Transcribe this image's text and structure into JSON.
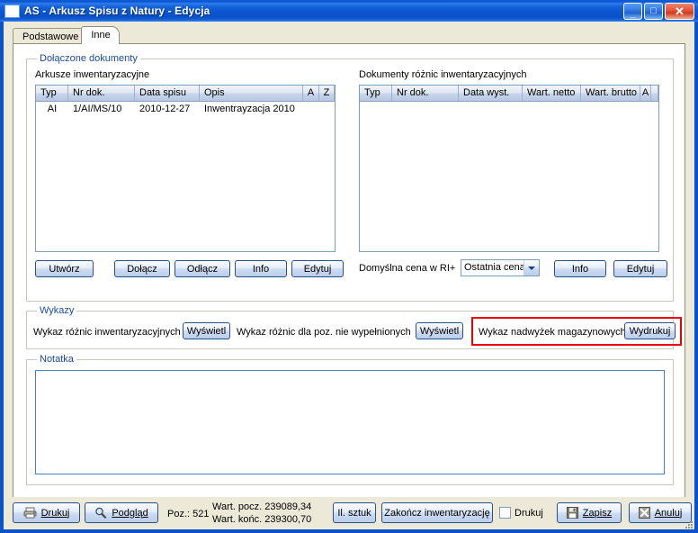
{
  "window": {
    "title": "AS - Arkusz Spisu z Natury - Edycja",
    "icon": "window-icon",
    "buttons": {
      "minimize": "_",
      "maximize": "□",
      "close": "✕"
    }
  },
  "tabs": [
    {
      "label": "Podstawowe",
      "active": false
    },
    {
      "label": "Inne",
      "active": true
    }
  ],
  "groups": {
    "attached_documents": {
      "legend": "Dołączone dokumenty"
    },
    "lists": {
      "legend": "Wykazy"
    },
    "note": {
      "legend": "Notatka"
    }
  },
  "inventory_sheets": {
    "label": "Arkusze inwentaryzacyjne",
    "columns": [
      "Typ",
      "Nr dok.",
      "Data spisu",
      "Opis",
      "A",
      "Z"
    ],
    "rows": [
      {
        "typ": "AI",
        "nr_dok": "1/AI/MS/10",
        "data_spisu": "2010-12-27",
        "opis": "Inwentrayzacja 2010",
        "a": "",
        "z": ""
      }
    ]
  },
  "difference_documents": {
    "label": "Dokumenty różnic inwentaryzacyjnych",
    "columns": [
      "Typ",
      "Nr dok.",
      "Data wyst.",
      "Wart. netto",
      "Wart. brutto",
      "A",
      ""
    ],
    "rows": []
  },
  "doc_buttons": {
    "create": "Utwórz",
    "attach": "Dołącz",
    "detach": "Odłącz",
    "info": "Info",
    "edit": "Edytuj"
  },
  "default_price": {
    "label": "Domyślna cena w RI+",
    "value": "Ostatnia cena z",
    "info": "Info",
    "edit": "Edytuj"
  },
  "reports": {
    "differences": {
      "label": "Wykaz różnic inwentaryzacyjnych",
      "button": "Wyświetl"
    },
    "unfilled": {
      "label": "Wykaz różnic dla poz. nie wypełnionych",
      "button": "Wyświetl"
    },
    "surplus": {
      "label": "Wykaz nadwyżek magazynowych",
      "button": "Wydrukuj",
      "highlighted": true
    }
  },
  "note_text": "",
  "footer": {
    "print": "Drukuj",
    "preview": "Podgląd",
    "position": "Poz.: 521",
    "value_start": "Wart. pocz.  239089,34",
    "value_end": "Wart. końc.  239300,70",
    "quantity": "Il. sztuk",
    "finish": "Zakończ inwentaryzację",
    "print_checkbox": "Drukuj",
    "print_checked": false,
    "save": "Zapisz",
    "cancel": "Anuluj"
  },
  "colors": {
    "titlebar": "#0a52c8",
    "accent_legend": "#1b4b9e",
    "highlight": "#ee0000",
    "panel": "#ece9d8"
  }
}
